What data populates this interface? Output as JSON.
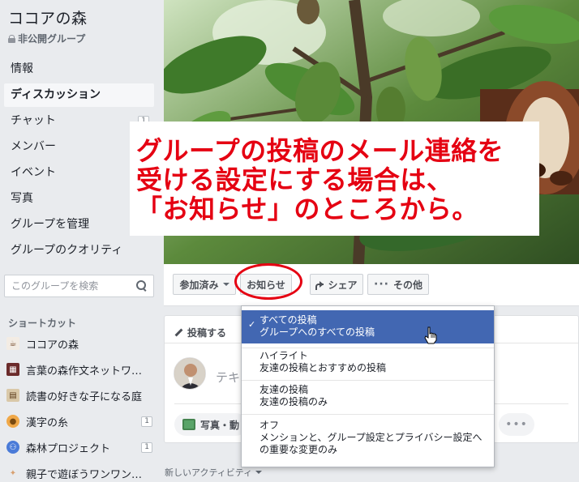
{
  "sidebar": {
    "group_name": "ココアの森",
    "privacy": "非公開グループ",
    "nav": [
      {
        "label": "情報",
        "active": false,
        "badge": ""
      },
      {
        "label": "ディスカッション",
        "active": true,
        "badge": ""
      },
      {
        "label": "チャット",
        "active": false,
        "badge": "1"
      },
      {
        "label": "メンバー",
        "active": false,
        "badge": ""
      },
      {
        "label": "イベント",
        "active": false,
        "badge": ""
      },
      {
        "label": "写真",
        "active": false,
        "badge": ""
      },
      {
        "label": "グループを管理",
        "active": false,
        "badge": ""
      },
      {
        "label": "グループのクオリティ",
        "active": false,
        "badge": ""
      }
    ],
    "search_placeholder": "このグループを検索",
    "shortcuts_heading": "ショートカット",
    "shortcuts": [
      {
        "label": "ココアの森",
        "icon": "cocoa-cup-icon",
        "badge": ""
      },
      {
        "label": "言葉の森作文ネットワ…",
        "icon": "grid-icon",
        "badge": ""
      },
      {
        "label": "読書の好きな子になる庭",
        "icon": "book-icon",
        "badge": ""
      },
      {
        "label": "漢字の糸",
        "icon": "paw-icon",
        "badge": "1"
      },
      {
        "label": "森林プロジェクト",
        "icon": "group-people-icon",
        "badge": "1"
      },
      {
        "label": "親子で遊ぼうワンワン…",
        "icon": "bone-icon",
        "badge": ""
      }
    ]
  },
  "callout": {
    "lines": [
      "グループの投稿のメール連絡を",
      "受ける設定にする場合は、",
      "「お知らせ」のところから。"
    ]
  },
  "action_bar": {
    "joined_label": "参加済み",
    "notify_label": "お知らせ",
    "share_label": "シェア",
    "more_label": "その他"
  },
  "composer": {
    "tab_label": "投稿する",
    "placeholder": "テキスト",
    "photo_label": "写真・動",
    "more_dots": "•••"
  },
  "dropdown": {
    "items": [
      {
        "title": "すべての投稿",
        "desc": "グループへのすべての投稿",
        "selected": true
      },
      {
        "title": "ハイライト",
        "desc": "友達の投稿とおすすめの投稿",
        "selected": false
      },
      {
        "title": "友達の投稿",
        "desc": "友達の投稿のみ",
        "selected": false
      },
      {
        "title": "オフ",
        "desc": "メンションと、グループ設定とプライバシー設定への重要な変更のみ",
        "selected": false
      }
    ]
  },
  "feed": {
    "activity_label": "新しいアクティビティ"
  },
  "colors": {
    "accent_red": "#e50012",
    "fb_blue": "#4267b2",
    "page_bg": "#e9ebee"
  }
}
